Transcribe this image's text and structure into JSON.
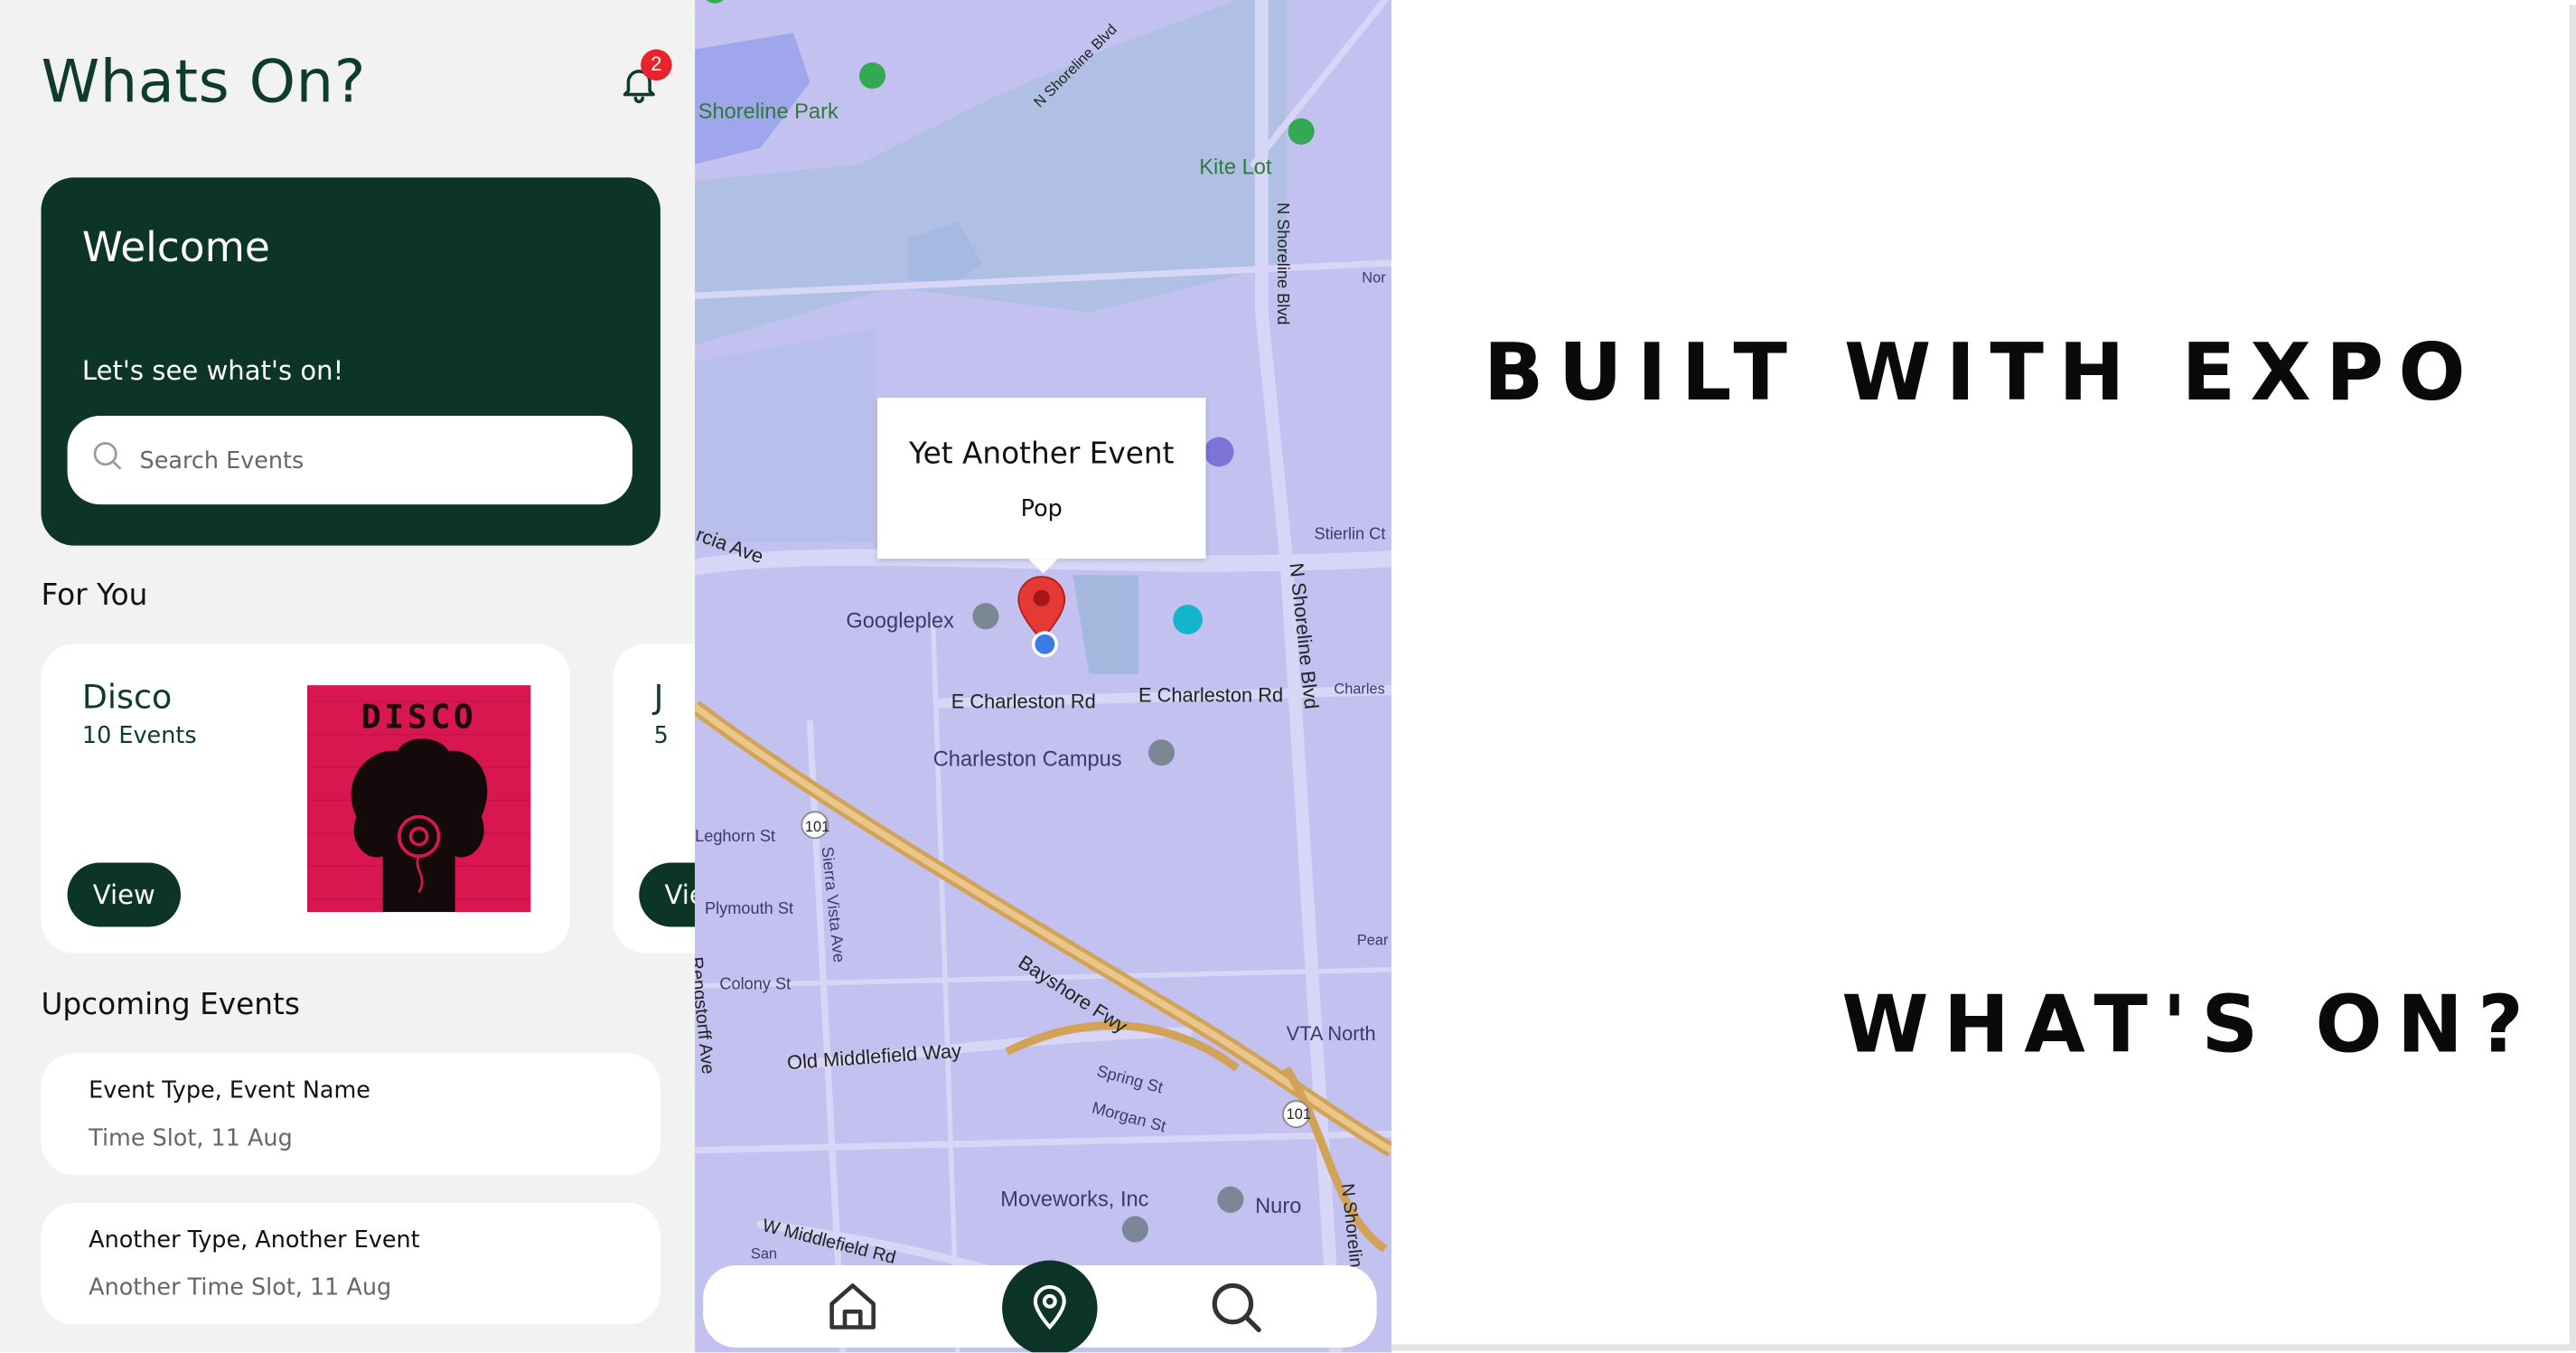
{
  "app": {
    "title": "Whats On?",
    "notification_count": "2"
  },
  "welcome": {
    "title": "Welcome",
    "subtitle": "Let's see what's on!",
    "search_placeholder": "Search Events"
  },
  "for_you": {
    "title": "For You",
    "cards": [
      {
        "name": "Disco",
        "count": "10 Events",
        "button": "View",
        "image_text": "DISCO"
      },
      {
        "name": "J",
        "count": "5",
        "button": "View"
      }
    ]
  },
  "upcoming": {
    "title": "Upcoming Events",
    "events": [
      {
        "name": "Event Type, Event Name",
        "time": "Time Slot, 11 Aug"
      },
      {
        "name": "Another Type, Another Event",
        "time": "Another Time Slot, 11 Aug"
      }
    ]
  },
  "map": {
    "callout_title": "Yet Another Event",
    "callout_sub": "Pop",
    "labels": {
      "shoreline_park": "Shoreline Park",
      "kite_lot": "Kite Lot",
      "googleplex": "Googleplex",
      "charleston_campus": "Charleston Campus",
      "e_charleston_1": "E Charleston Rd",
      "e_charleston_2": "E Charleston Rd",
      "moveworks": "Moveworks, Inc",
      "nuro": "Nuro",
      "vta": "VTA North",
      "old_middlefield": "Old Middlefield Way",
      "bayshore": "Bayshore Fwy",
      "stierlin": "Stierlin Ct",
      "n_shoreline_1": "N Shoreline Blvd",
      "n_shoreline_2": "N Shoreline Blvd",
      "n_shoreline_3": "N Shoreline Blvd",
      "n_shoreline_4": "N Shoreline Blvd",
      "w_middlefield": "W Middlefield Rd",
      "plymouth": "Plymouth St",
      "colony": "Colony St",
      "leghorn": "Leghorn St",
      "sierra_vista": "Sierra Vista Ave",
      "spring": "Spring St",
      "morgan": "Morgan St",
      "rengstorff": "Rengstorff Ave",
      "garcia": "rcia Ave",
      "hwy101_a": "101",
      "hwy101_b": "101",
      "charles": "Charles",
      "pear": "Pear",
      "nor": "Nor",
      "san": "San"
    }
  },
  "tabs": {
    "home": "home-icon",
    "map": "map-pin-icon",
    "search": "search-icon"
  },
  "promo": {
    "line1": "BUILT WITH EXPO",
    "line2": "WHAT'S ON?"
  },
  "colors": {
    "primary_dark_green": "#0c3527",
    "title_green": "#0f3b2c",
    "badge_red": "#e8232b",
    "map_bg": "#c3c1ef",
    "disco_pink": "#d8164f"
  }
}
